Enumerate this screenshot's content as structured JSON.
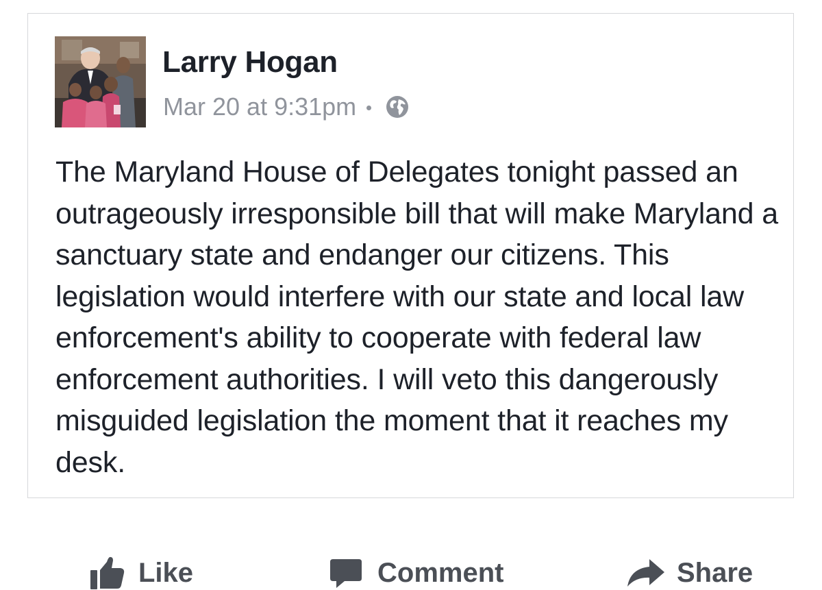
{
  "post": {
    "author": "Larry Hogan",
    "timestamp": "Mar 20 at 9:31pm",
    "privacy_icon": "globe-icon",
    "avatar_icon": "profile-photo",
    "text": "The Maryland House of Delegates tonight passed an outrageously irresponsible bill that will make Maryland a sanctuary state and endanger our citizens. This legislation would interfere with our state and local law enforcement's ability to cooperate with federal law enforcement authorities. I will veto this dangerously misguided legislation the moment that it reaches my desk."
  },
  "actions": {
    "like": {
      "label": "Like",
      "icon": "thumbs-up-icon"
    },
    "comment": {
      "label": "Comment",
      "icon": "comment-icon"
    },
    "share": {
      "label": "Share",
      "icon": "share-arrow-icon"
    }
  },
  "colors": {
    "text_primary": "#1d2129",
    "text_secondary": "#90949c",
    "action_gray": "#4b4f56",
    "card_border": "#d6d7da"
  }
}
